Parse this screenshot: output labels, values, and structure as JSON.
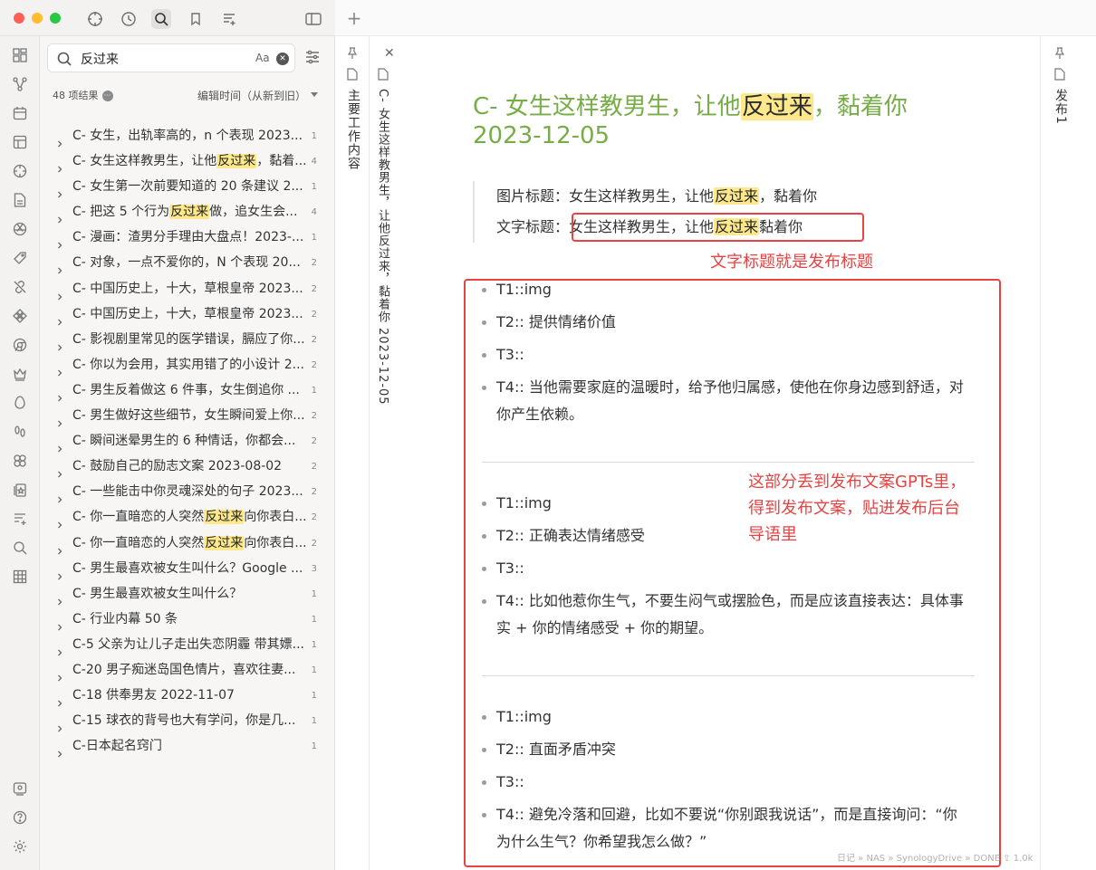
{
  "search": {
    "query": "反过来",
    "match_case_label": "Aa"
  },
  "results_header": {
    "count": "48 项结果",
    "sort": "编辑时间（从新到旧）"
  },
  "results": [
    {
      "before": "C- 女生，出轨率高的，n 个表现 2023...",
      "hl": "",
      "after": "",
      "count": "1"
    },
    {
      "before": "C- 女生这样教男生，让他",
      "hl": "反过来",
      "after": "，黏着...",
      "count": "4"
    },
    {
      "before": "C- 女生第一次前要知道的 20 条建议 2...",
      "hl": "",
      "after": "",
      "count": "1"
    },
    {
      "before": "C- 把这 5 个行为",
      "hl": "反过来",
      "after": "做，追女生会...",
      "count": "4"
    },
    {
      "before": "C- 漫画：渣男分手理由大盘点！2023-...",
      "hl": "",
      "after": "",
      "count": "1"
    },
    {
      "before": "C- 对象，一点不爱你的，N 个表现 20...",
      "hl": "",
      "after": "",
      "count": "2"
    },
    {
      "before": "C- 中国历史上，十大，草根皇帝 2023...",
      "hl": "",
      "after": "",
      "count": "2"
    },
    {
      "before": "C- 中国历史上，十大，草根皇帝 2023...",
      "hl": "",
      "after": "",
      "count": "2"
    },
    {
      "before": "C- 影视剧里常见的医学错误，膈应了你...",
      "hl": "",
      "after": "",
      "count": "2"
    },
    {
      "before": "C- 你以为会用，其实用错了的小设计 2...",
      "hl": "",
      "after": "",
      "count": "2"
    },
    {
      "before": "C- 男生反着做这 6 件事，女生倒追你 ...",
      "hl": "",
      "after": "",
      "count": "1"
    },
    {
      "before": "C- 男生做好这些细节，女生瞬间爱上你...",
      "hl": "",
      "after": "",
      "count": "2"
    },
    {
      "before": "C- 瞬间迷晕男生的 6 种情话，你都会...",
      "hl": "",
      "after": "",
      "count": "2"
    },
    {
      "before": "C- 鼓励自己的励志文案 2023-08-02",
      "hl": "",
      "after": "",
      "count": "2"
    },
    {
      "before": "C- 一些能击中你灵魂深处的句子 2023...",
      "hl": "",
      "after": "",
      "count": "2"
    },
    {
      "before": "C- 你一直暗恋的人突然",
      "hl": "反过来",
      "after": "向你表白...",
      "count": "2"
    },
    {
      "before": "C- 你一直暗恋的人突然",
      "hl": "反过来",
      "after": "向你表白...",
      "count": "2"
    },
    {
      "before": "C- 男生最喜欢被女生叫什么？Google ...",
      "hl": "",
      "after": "",
      "count": "3"
    },
    {
      "before": "C- 男生最喜欢被女生叫什么？",
      "hl": "",
      "after": "",
      "count": "1"
    },
    {
      "before": "C- 行业内幕 50 条",
      "hl": "",
      "after": "",
      "count": "1"
    },
    {
      "before": "C-5 父亲为让儿子走出失恋阴霾 带其嫖...",
      "hl": "",
      "after": "",
      "count": "1"
    },
    {
      "before": "C-20 男子痴迷岛国色情片，喜欢往妻...",
      "hl": "",
      "after": "",
      "count": "1"
    },
    {
      "before": "C-18 供奉男友 2022-11-07",
      "hl": "",
      "after": "",
      "count": "1"
    },
    {
      "before": "C-15 球衣的背号也大有学问，你是几...",
      "hl": "",
      "after": "",
      "count": "1"
    },
    {
      "before": "C-日本起名窍门",
      "hl": "",
      "after": "",
      "count": "1"
    }
  ],
  "left_tab": {
    "title": "主要工作内容"
  },
  "active_tab": {
    "title": "C- 女生这样教男生，让他反过来，黏着你 2023-12-05"
  },
  "right_tab": {
    "title": "发布1"
  },
  "note": {
    "title_before": "C- 女生这样教男生，让他",
    "title_hl": "反过来",
    "title_after": "，黏着你 2023-12-05",
    "img_title_label": "图片标题：",
    "img_title_before": "女生这样教男生，让他",
    "img_title_hl": "反过来",
    "img_title_after": "，黏着你",
    "text_title_label": "文字标题：",
    "text_title_before": "女生这样教男生，让他",
    "text_title_hl": "反过来",
    "text_title_after": "黏着你",
    "groups": [
      [
        "T1::img",
        "T2:: 提供情绪价值",
        "T3::",
        "T4:: 当他需要家庭的温暖时，给予他归属感，使他在你身边感到舒适，对你产生依赖。"
      ],
      [
        "T1::img",
        "T2:: 正确表达情绪感受",
        "T3::",
        "T4:: 比如他惹你生气，不要生闷气或摆脸色，而是应该直接表达：具体事实 + 你的情绪感受 + 你的期望。"
      ],
      [
        "T1::img",
        "T2:: 直面矛盾冲突",
        "T3::",
        "T4:: 避免冷落和回避，比如不要说“你别跟我说话”，而是直接询问：“你为什么生气？你希望我怎么做？”"
      ]
    ]
  },
  "annotations": {
    "a1": "文字标题就是发布标题",
    "a2_l1": "这部分丢到发布文案GPTs里，",
    "a2_l2": "得到发布文案，贴进发布后台",
    "a2_l3": "导语里"
  },
  "status_bar": {
    "path": "日记 » NAS » SynologyDrive » DONE",
    "words": "1.0k"
  },
  "colors": {
    "accent_green": "#77ad47",
    "highlight": "#fde98c",
    "annotation_red": "#e84242"
  }
}
